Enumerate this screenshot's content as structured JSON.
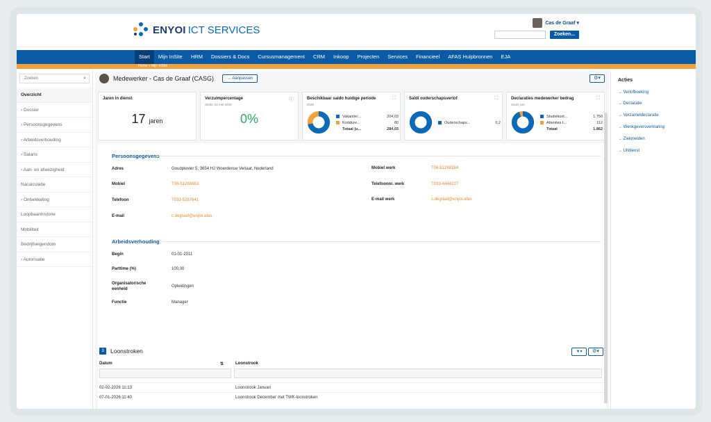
{
  "brand": {
    "name_bold": "ENYOI",
    "name_rest": "ICT SERVICES"
  },
  "user": {
    "name": "Cas de Graaf ▾",
    "search_button": "Zoeken..."
  },
  "nav": {
    "items": [
      "Start",
      "Mijn InSite",
      "HRM",
      "Dossiers & Docs",
      "Cursusmanagement",
      "CRM",
      "Inkoop",
      "Projecten",
      "Services",
      "Financieel",
      "AFAS Hulpbronnen",
      "EJA"
    ]
  },
  "breadcrumb": "Home » Mijn InSite",
  "sidebar": {
    "search_placeholder": "Zoeken",
    "items": [
      "Overzicht",
      "› Dossier",
      "› Persoonsgegevens",
      "› Arbeidsverhouding",
      "› Salaris",
      "› Aan- en afwezigheid",
      "Nacalculatie",
      "› Ontwikkeling",
      "Loopbaanhistorie",
      "Mobiliteit",
      "Bedrijfseigendom",
      "› Autorisatie"
    ]
  },
  "page": {
    "title": "Medewerker - Cas de Graaf (CASG)",
    "adjust_button": "→ Aanpassen"
  },
  "tiles": {
    "years": {
      "title": "Jaren in dienst",
      "value": "17",
      "unit": "jaren"
    },
    "absence": {
      "title": "Verzuimpercentage",
      "sub": "Sinds: 22 mei 2025",
      "value": "0%"
    },
    "saldo": {
      "title": "Beschikbaar saldo huidige periode",
      "sub": "2026",
      "rows": [
        {
          "label": "Vakantie/...",
          "value": "204,03"
        },
        {
          "label": "Kortdure...",
          "value": "80"
        }
      ],
      "total_label": "Totaal (u...",
      "total_value": "284,03"
    },
    "ouderschap": {
      "title": "Saldi ouderschapsverlof",
      "row_label": "Ouderschaps...",
      "row_value": "0,2"
    },
    "declaraties": {
      "title": "Declaraties medewerker bedrag",
      "sub": "Sinds juni",
      "rows": [
        {
          "label": "Studiekost...",
          "value": "1.750"
        },
        {
          "label": "Attenties t...",
          "value": "112"
        }
      ],
      "total_label": "Totaal",
      "total_value": "1.862"
    }
  },
  "persons": {
    "title": "Persoonsgegevens",
    "adres_label": "Adres",
    "adres_value": "Goudplevier 5, 3654 HJ Woerdense Verlaat, Nederland",
    "mobiel_label": "Mobiel",
    "mobiel_value": "T06-51268883",
    "telefoon_label": "Telefoon",
    "telefoon_value": "T033-5287641",
    "email_label": "E-mail",
    "email_value": "c.degraaf@enyoi.afas",
    "mobiel_werk_label": "Mobiel werk",
    "mobiel_werk_value": "T06-51268384",
    "telefoon_werk_label": "Telefoonnr. werk",
    "telefoon_werk_value": "T033-4444237",
    "email_werk_label": "E-mail werk",
    "email_werk_value": "c.degraaf@enyoi.afas"
  },
  "arbeid": {
    "title": "Arbeidsverhouding",
    "begin_label": "Begin",
    "begin_value": "01-01-2011",
    "parttime_label": "Parttime (%)",
    "parttime_value": "100,00",
    "org_label": "Organisatorische eenheid",
    "org_value": "Opleidingen",
    "functie_label": "Functie",
    "functie_value": "Manager"
  },
  "loonstroken": {
    "badge": "3",
    "title": "Loonstroken",
    "col_datum": "Datum",
    "col_loonstrook": "Loonstrook",
    "rows": [
      {
        "datum": "02-02-2026 11:13",
        "loonstrook": "Loonstrook Januari"
      },
      {
        "datum": "07-01-2026 11:40",
        "loonstrook": "Loonstrook December met TWK-loonstroken"
      }
    ]
  },
  "acties": {
    "title": "Acties",
    "items": [
      "→ Verlofboeking",
      "→ Declaratie",
      "→ Verzameldeclaratie",
      "→ Wenkgeversverklaring",
      "→ Ziekmelden",
      "→ Uitdienst"
    ]
  },
  "colors": {
    "primary": "#0a5aa5",
    "accent": "#f0a23a",
    "link": "#e88a2c",
    "success": "#27ae60"
  }
}
